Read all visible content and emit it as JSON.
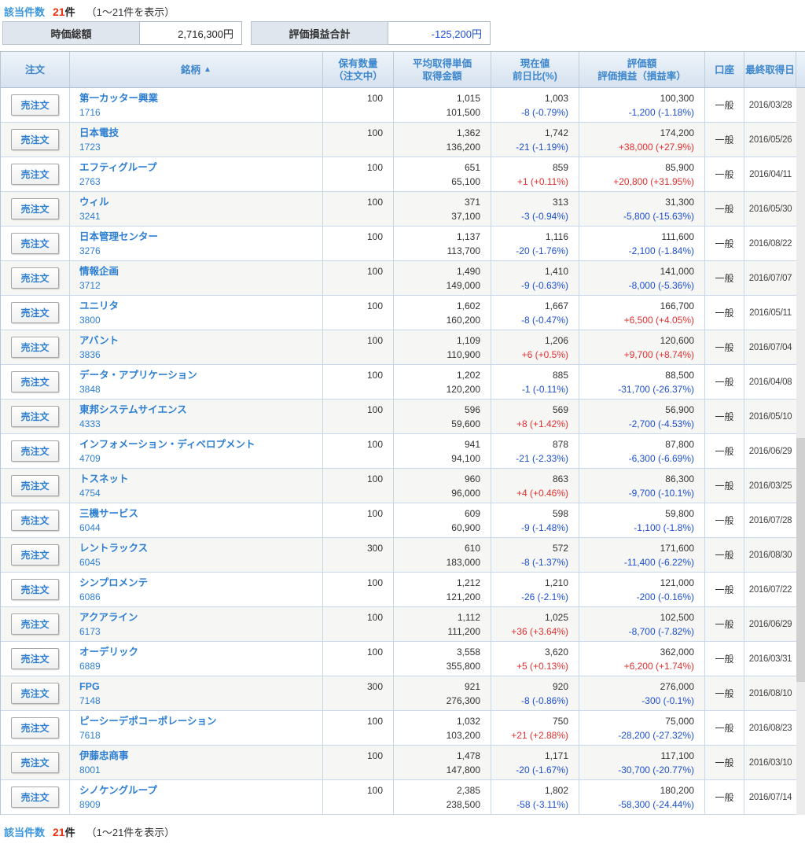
{
  "colors": {
    "accent_blue": "#2e7fd2",
    "loss_blue": "#1d50d0",
    "gain_red": "#e0312e",
    "count_red": "#e8320f"
  },
  "meta": {
    "result_count_label": "該当件数",
    "result_count": "21",
    "result_count_unit": "件",
    "result_range": "（1〜21件を表示）"
  },
  "summary": {
    "market_value_label": "時価総額",
    "market_value": "2,716,300円",
    "pl_total_label": "評価損益合計",
    "pl_total": "-125,200円"
  },
  "table": {
    "sell_button_label": "売注文",
    "headers": {
      "order": "注文",
      "stock": "銘柄",
      "sort_icon": "▲",
      "qty_1": "保有数量",
      "qty_2": "（注文中）",
      "avg_1": "平均取得単価",
      "avg_2": "取得金額",
      "price_1": "現在値",
      "price_2": "前日比(%)",
      "value_1": "評価額",
      "value_2": "評価損益（損益率）",
      "account": "口座",
      "date": "最終取得日"
    },
    "rows": [
      {
        "name": "第一カッター興業",
        "code": "1716",
        "qty": "100",
        "avg_price": "1,015",
        "cost": "101,500",
        "price": "1,003",
        "change": "-8 (-0.79%)",
        "value": "100,300",
        "pl": "-1,200 (-1.18%)",
        "account": "一般",
        "date": "2016/03/28"
      },
      {
        "name": "日本電技",
        "code": "1723",
        "qty": "100",
        "avg_price": "1,362",
        "cost": "136,200",
        "price": "1,742",
        "change": "-21 (-1.19%)",
        "value": "174,200",
        "pl": "+38,000 (+27.9%)",
        "account": "一般",
        "date": "2016/05/26"
      },
      {
        "name": "エフティグループ",
        "code": "2763",
        "qty": "100",
        "avg_price": "651",
        "cost": "65,100",
        "price": "859",
        "change": "+1 (+0.11%)",
        "value": "85,900",
        "pl": "+20,800 (+31.95%)",
        "account": "一般",
        "date": "2016/04/11"
      },
      {
        "name": "ウィル",
        "code": "3241",
        "qty": "100",
        "avg_price": "371",
        "cost": "37,100",
        "price": "313",
        "change": "-3 (-0.94%)",
        "value": "31,300",
        "pl": "-5,800 (-15.63%)",
        "account": "一般",
        "date": "2016/05/30"
      },
      {
        "name": "日本管理センター",
        "code": "3276",
        "qty": "100",
        "avg_price": "1,137",
        "cost": "113,700",
        "price": "1,116",
        "change": "-20 (-1.76%)",
        "value": "111,600",
        "pl": "-2,100 (-1.84%)",
        "account": "一般",
        "date": "2016/08/22"
      },
      {
        "name": "情報企画",
        "code": "3712",
        "qty": "100",
        "avg_price": "1,490",
        "cost": "149,000",
        "price": "1,410",
        "change": "-9 (-0.63%)",
        "value": "141,000",
        "pl": "-8,000 (-5.36%)",
        "account": "一般",
        "date": "2016/07/07"
      },
      {
        "name": "ユニリタ",
        "code": "3800",
        "qty": "100",
        "avg_price": "1,602",
        "cost": "160,200",
        "price": "1,667",
        "change": "-8 (-0.47%)",
        "value": "166,700",
        "pl": "+6,500 (+4.05%)",
        "account": "一般",
        "date": "2016/05/11"
      },
      {
        "name": "アバント",
        "code": "3836",
        "qty": "100",
        "avg_price": "1,109",
        "cost": "110,900",
        "price": "1,206",
        "change": "+6 (+0.5%)",
        "value": "120,600",
        "pl": "+9,700 (+8.74%)",
        "account": "一般",
        "date": "2016/07/04"
      },
      {
        "name": "データ・アプリケーション",
        "code": "3848",
        "qty": "100",
        "avg_price": "1,202",
        "cost": "120,200",
        "price": "885",
        "change": "-1 (-0.11%)",
        "value": "88,500",
        "pl": "-31,700 (-26.37%)",
        "account": "一般",
        "date": "2016/04/08"
      },
      {
        "name": "東邦システムサイエンス",
        "code": "4333",
        "qty": "100",
        "avg_price": "596",
        "cost": "59,600",
        "price": "569",
        "change": "+8 (+1.42%)",
        "value": "56,900",
        "pl": "-2,700 (-4.53%)",
        "account": "一般",
        "date": "2016/05/10"
      },
      {
        "name": "インフォメーション・ディベロプメント",
        "code": "4709",
        "qty": "100",
        "avg_price": "941",
        "cost": "94,100",
        "price": "878",
        "change": "-21 (-2.33%)",
        "value": "87,800",
        "pl": "-6,300 (-6.69%)",
        "account": "一般",
        "date": "2016/06/29"
      },
      {
        "name": "トスネット",
        "code": "4754",
        "qty": "100",
        "avg_price": "960",
        "cost": "96,000",
        "price": "863",
        "change": "+4 (+0.46%)",
        "value": "86,300",
        "pl": "-9,700 (-10.1%)",
        "account": "一般",
        "date": "2016/03/25"
      },
      {
        "name": "三機サービス",
        "code": "6044",
        "qty": "100",
        "avg_price": "609",
        "cost": "60,900",
        "price": "598",
        "change": "-9 (-1.48%)",
        "value": "59,800",
        "pl": "-1,100 (-1.8%)",
        "account": "一般",
        "date": "2016/07/28"
      },
      {
        "name": "レントラックス",
        "code": "6045",
        "qty": "300",
        "avg_price": "610",
        "cost": "183,000",
        "price": "572",
        "change": "-8 (-1.37%)",
        "value": "171,600",
        "pl": "-11,400 (-6.22%)",
        "account": "一般",
        "date": "2016/08/30"
      },
      {
        "name": "シンプロメンテ",
        "code": "6086",
        "qty": "100",
        "avg_price": "1,212",
        "cost": "121,200",
        "price": "1,210",
        "change": "-26 (-2.1%)",
        "value": "121,000",
        "pl": "-200 (-0.16%)",
        "account": "一般",
        "date": "2016/07/22"
      },
      {
        "name": "アクアライン",
        "code": "6173",
        "qty": "100",
        "avg_price": "1,112",
        "cost": "111,200",
        "price": "1,025",
        "change": "+36 (+3.64%)",
        "value": "102,500",
        "pl": "-8,700 (-7.82%)",
        "account": "一般",
        "date": "2016/06/29"
      },
      {
        "name": "オーデリック",
        "code": "6889",
        "qty": "100",
        "avg_price": "3,558",
        "cost": "355,800",
        "price": "3,620",
        "change": "+5 (+0.13%)",
        "value": "362,000",
        "pl": "+6,200 (+1.74%)",
        "account": "一般",
        "date": "2016/03/31"
      },
      {
        "name": "FPG",
        "code": "7148",
        "qty": "300",
        "avg_price": "921",
        "cost": "276,300",
        "price": "920",
        "change": "-8 (-0.86%)",
        "value": "276,000",
        "pl": "-300 (-0.1%)",
        "account": "一般",
        "date": "2016/08/10"
      },
      {
        "name": "ピーシーデポコーポレーション",
        "code": "7618",
        "qty": "100",
        "avg_price": "1,032",
        "cost": "103,200",
        "price": "750",
        "change": "+21 (+2.88%)",
        "value": "75,000",
        "pl": "-28,200 (-27.32%)",
        "account": "一般",
        "date": "2016/08/23"
      },
      {
        "name": "伊藤忠商事",
        "code": "8001",
        "qty": "100",
        "avg_price": "1,478",
        "cost": "147,800",
        "price": "1,171",
        "change": "-20 (-1.67%)",
        "value": "117,100",
        "pl": "-30,700 (-20.77%)",
        "account": "一般",
        "date": "2016/03/10"
      },
      {
        "name": "シノケングループ",
        "code": "8909",
        "qty": "100",
        "avg_price": "2,385",
        "cost": "238,500",
        "price": "1,802",
        "change": "-58 (-3.11%)",
        "value": "180,200",
        "pl": "-58,300 (-24.44%)",
        "account": "一般",
        "date": "2016/07/14"
      }
    ]
  }
}
